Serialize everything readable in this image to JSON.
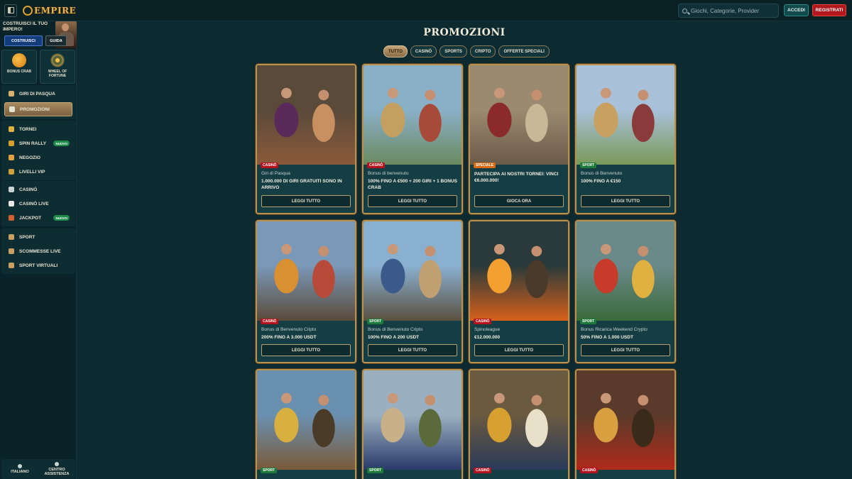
{
  "brand": {
    "logo_text": "EMPIRE"
  },
  "search": {
    "placeholder": "Giochi, Categorie, Provider"
  },
  "auth": {
    "login_label": "ACCEDI",
    "register_label": "REGISTRATI"
  },
  "sidebar": {
    "promo": {
      "title": "COSTRUISCI IL TUO IMPERO!",
      "build_label": "COSTRUISCI",
      "guide_label": "GUIDA"
    },
    "tiles": [
      {
        "label": "BONUS CRAB",
        "icon": "coin-icon"
      },
      {
        "label": "WHEEL OF FORTUNE",
        "icon": "wheel-icon"
      }
    ],
    "groups": [
      [
        {
          "label": "GIRI DI PASQUA",
          "icon": "egg-icon"
        },
        {
          "label": "PROMOZIONI",
          "icon": "gift-icon",
          "active": true
        }
      ],
      [
        {
          "label": "TORNEI",
          "icon": "trophy-icon"
        },
        {
          "label": "SPIN RALLY",
          "icon": "spin-icon",
          "badge": "NUOVO"
        },
        {
          "label": "NEGOZIO",
          "icon": "shop-icon"
        },
        {
          "label": "LIVELLI VIP",
          "icon": "vip-icon"
        }
      ],
      [
        {
          "label": "CASINÒ",
          "icon": "slot-icon"
        },
        {
          "label": "CASINÒ LIVE",
          "icon": "cards-icon"
        },
        {
          "label": "JACKPOT",
          "icon": "jackpot-icon",
          "badge": "NUOVO"
        }
      ],
      [
        {
          "label": "SPORT",
          "icon": "sport-icon"
        },
        {
          "label": "SCOMMESSE LIVE",
          "icon": "live-bet-icon"
        },
        {
          "label": "SPORT VIRTUALI",
          "icon": "virtual-sport-icon"
        }
      ]
    ],
    "bottom": {
      "language_label": "ITALIANO",
      "help_label": "CENTRO ASSISTENZA"
    }
  },
  "page": {
    "title": "PROMOZIONI"
  },
  "filters": [
    {
      "label": "TUTTO",
      "active": true
    },
    {
      "label": "CASINÒ"
    },
    {
      "label": "SPORTS"
    },
    {
      "label": "CRIPTO"
    },
    {
      "label": "OFFERTE SPECIALI"
    }
  ],
  "cards": [
    {
      "tag": "CASINÒ",
      "tag_type": "casino",
      "subtitle": "Giri di Pasqua",
      "headline": "1.000.000 DI GIRI GRATUITI SONO IN ARRIVO",
      "cta": "LEGGI TUTTO",
      "art": "feast"
    },
    {
      "tag": "CASINÒ",
      "tag_type": "casino",
      "subtitle": "Bonus di benvenuto",
      "headline": "100% FINO A €500 + 200 GIRI + 1 BONUS CRAB",
      "cta": "LEGGI TUTTO",
      "art": "ships"
    },
    {
      "tag": "SPECIALE",
      "tag_type": "speciale",
      "subtitle": "",
      "headline": "PARTECIPA AI NOSTRI TORNEI: VINCI €6.000.000!",
      "cta": "GIOCA ORA",
      "art": "joust"
    },
    {
      "tag": "SPORT",
      "tag_type": "sport",
      "subtitle": "Bonus di Benvenuto",
      "headline": "100% FINO A €150",
      "cta": "LEGGI TUTTO",
      "art": "tournament"
    },
    {
      "tag": "CASINÒ",
      "tag_type": "casino",
      "subtitle": "Bonus di Benvenuto Cripto",
      "headline": "200% FINO A 3.000 USDT",
      "cta": "LEGGI TUTTO",
      "art": "bitcoin"
    },
    {
      "tag": "SPORT",
      "tag_type": "sport",
      "subtitle": "Bonus di Benvenuto Cripto",
      "headline": "100% FINO A 200 USDT",
      "cta": "LEGGI TUTTO",
      "art": "warriors"
    },
    {
      "tag": "CASINÒ",
      "tag_type": "casino",
      "subtitle": "Spinoleague",
      "headline": "€12.000.000",
      "cta": "LEGGI TUTTO",
      "art": "fire"
    },
    {
      "tag": "SPORT",
      "tag_type": "sport",
      "subtitle": "Bonus Ricarica Weekend Crypto",
      "headline": "50% FINO A 1.000 USDT",
      "cta": "LEGGI TUTTO",
      "art": "jester"
    },
    {
      "tag": "SPORT",
      "tag_type": "sport",
      "subtitle": "",
      "headline": "",
      "cta": "",
      "art": "pirates"
    },
    {
      "tag": "SPORT",
      "tag_type": "sport",
      "subtitle": "",
      "headline": "",
      "cta": "",
      "art": "generals"
    },
    {
      "tag": "CASINÒ",
      "tag_type": "casino",
      "subtitle": "",
      "headline": "",
      "cta": "",
      "art": "treasure"
    },
    {
      "tag": "CASINÒ",
      "tag_type": "casino",
      "subtitle": "",
      "headline": "",
      "cta": "",
      "art": "emperor"
    }
  ]
}
